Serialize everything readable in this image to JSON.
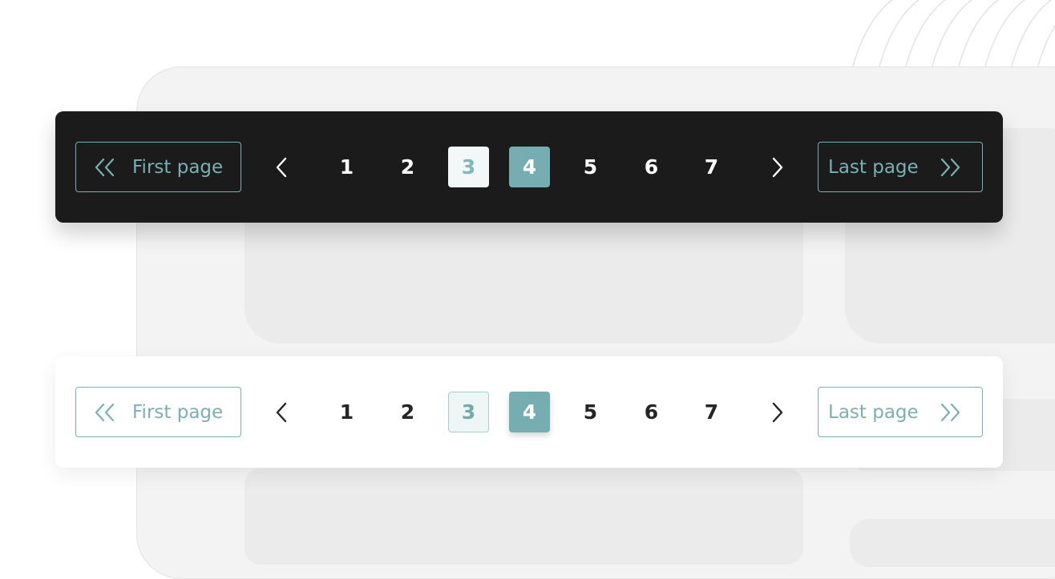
{
  "accent_color": "#76adb0",
  "dark_pager": {
    "background": "#1b1b1b",
    "first_label": "First page",
    "last_label": "Last page",
    "pages": [
      "1",
      "2",
      "3",
      "4",
      "5",
      "6",
      "7"
    ],
    "visited_page": "3",
    "current_page": "4",
    "icons": {
      "first": "double-chevron-left-icon",
      "prev": "chevron-left-icon",
      "next": "chevron-right-icon",
      "last": "double-chevron-right-icon"
    }
  },
  "light_pager": {
    "background": "#ffffff",
    "first_label": "First page",
    "last_label": "Last page",
    "pages": [
      "1",
      "2",
      "3",
      "4",
      "5",
      "6",
      "7"
    ],
    "visited_page": "3",
    "current_page": "4",
    "icons": {
      "first": "double-chevron-left-icon",
      "prev": "chevron-left-icon",
      "next": "chevron-right-icon",
      "last": "double-chevron-right-icon"
    }
  }
}
